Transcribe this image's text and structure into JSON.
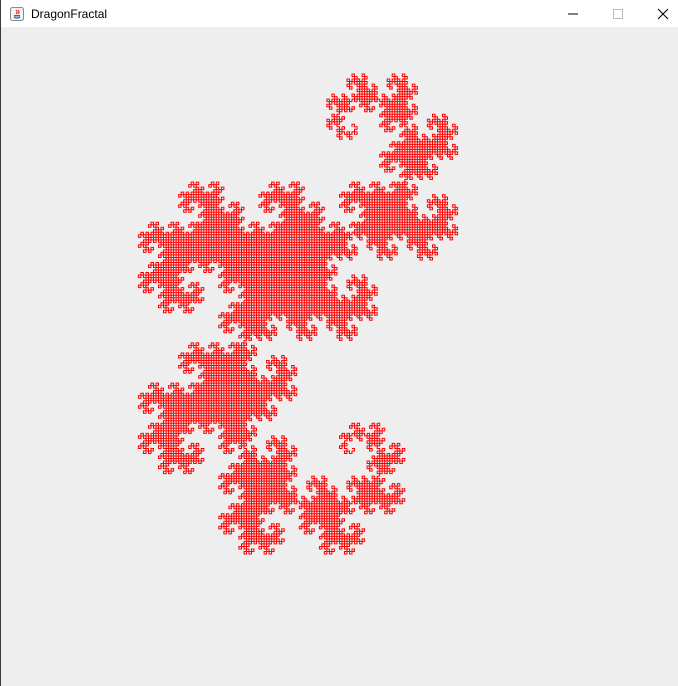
{
  "window": {
    "title": "DragonFractal",
    "controls": {
      "minimize_icon": "minimize-icon",
      "maximize_icon": "maximize-icon",
      "close_icon": "close-icon"
    }
  },
  "canvas": {
    "background": "#eeeeee",
    "fractal": {
      "type": "dragon curve",
      "color": "#ff0000"
    }
  }
}
